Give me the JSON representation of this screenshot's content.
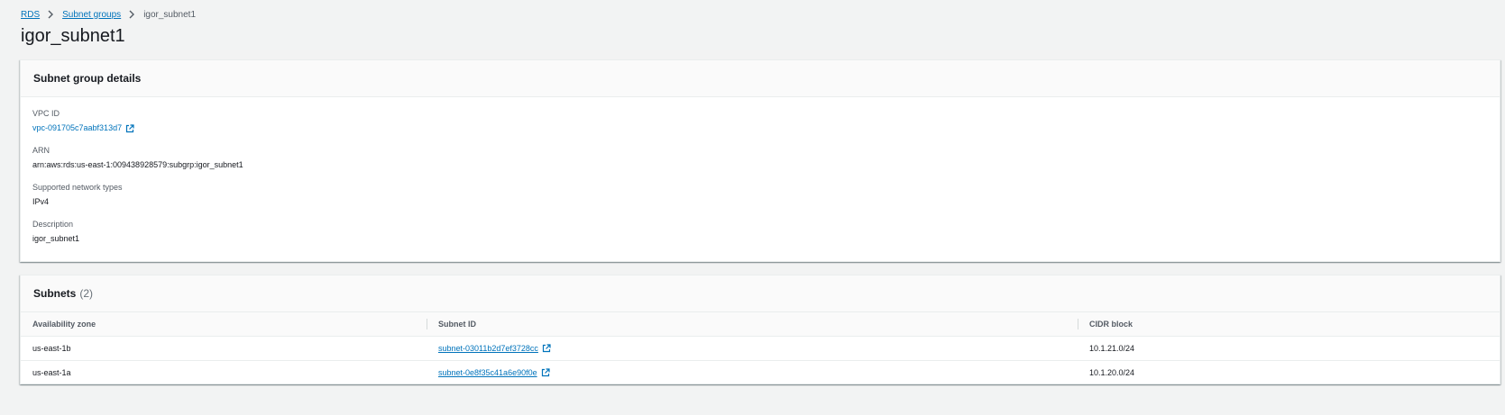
{
  "breadcrumb": {
    "items": [
      "RDS",
      "Subnet groups"
    ],
    "current": "igor_subnet1"
  },
  "page_title": "igor_subnet1",
  "details": {
    "title": "Subnet group details",
    "vpc_label": "VPC ID",
    "vpc_value": "vpc-091705c7aabf313d7",
    "arn_label": "ARN",
    "arn_value": "arn:aws:rds:us-east-1:009438928579:subgrp:igor_subnet1",
    "network_label": "Supported network types",
    "network_value": "IPv4",
    "description_label": "Description",
    "description_value": "igor_subnet1"
  },
  "subnets": {
    "title": "Subnets",
    "count": "(2)",
    "columns": [
      "Availability zone",
      "Subnet ID",
      "CIDR block"
    ],
    "rows": [
      {
        "az": "us-east-1b",
        "subnet_id": "subnet-03011b2d7ef3728cc",
        "cidr": "10.1.21.0/24"
      },
      {
        "az": "us-east-1a",
        "subnet_id": "subnet-0e8f35c41a6e90f0e",
        "cidr": "10.1.20.0/24"
      }
    ]
  },
  "icons": {
    "separator": "chevron-right-icon",
    "external": "external-link-icon"
  },
  "colors": {
    "link": "#0073bb",
    "background": "#f2f3f3",
    "text": "#16191f"
  }
}
